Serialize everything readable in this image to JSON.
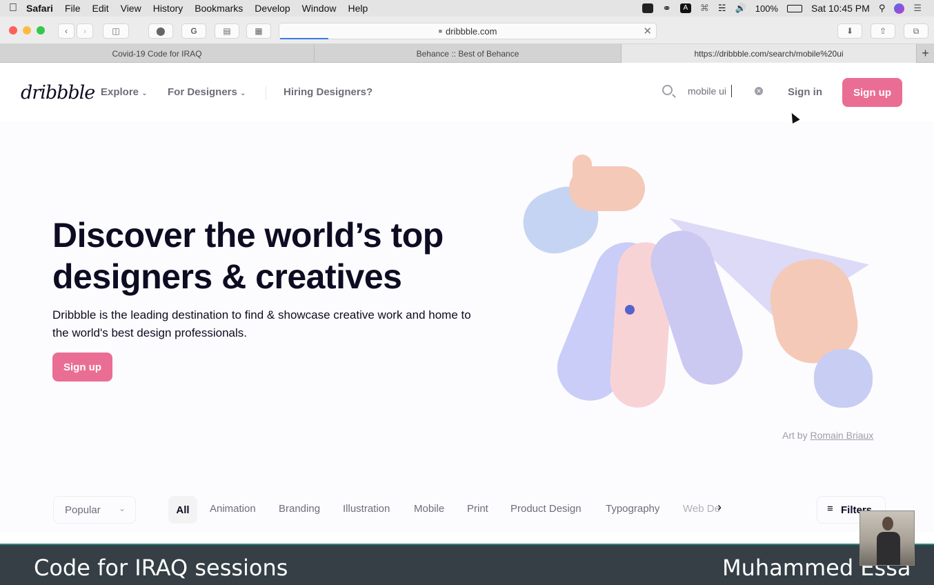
{
  "menubar": {
    "app": "Safari",
    "items": [
      "File",
      "Edit",
      "View",
      "History",
      "Bookmarks",
      "Develop",
      "Window",
      "Help"
    ],
    "battery": "100%",
    "clock": "Sat 10:45 PM"
  },
  "browser": {
    "address": "dribbble.com",
    "tabs": [
      {
        "label": "Covid-19 Code for IRAQ"
      },
      {
        "label": "Behance :: Best of Behance"
      },
      {
        "label": "https://dribbble.com/search/mobile%20ui"
      }
    ]
  },
  "site": {
    "logo": "dribbble",
    "nav": [
      {
        "label": "Explore"
      },
      {
        "label": "For Designers"
      },
      {
        "label": "Hiring Designers?"
      }
    ],
    "search_value": "mobile ui",
    "sign_in": "Sign in",
    "sign_up": "Sign up"
  },
  "hero": {
    "title_line1": "Discover the world’s top",
    "title_line2": "designers & creatives",
    "description_line1": "Dribbble is the leading destination to find & showcase creative work and home to",
    "description_line2": "the world's best design professionals.",
    "cta": "Sign up",
    "art_prefix": "Art by",
    "art_author": "Romain Briaux"
  },
  "filters": {
    "sort": "Popular",
    "categories": [
      "All",
      "Animation",
      "Branding",
      "Illustration",
      "Mobile",
      "Print",
      "Product Design",
      "Typography",
      "Web De"
    ],
    "active_category": "All",
    "filters_label": "Filters"
  },
  "banner": {
    "left": "Code for IRAQ sessions",
    "right": "Muhammed Essa"
  },
  "colors": {
    "brand_pink": "#ea6e93",
    "banner_bg": "#353f45"
  }
}
